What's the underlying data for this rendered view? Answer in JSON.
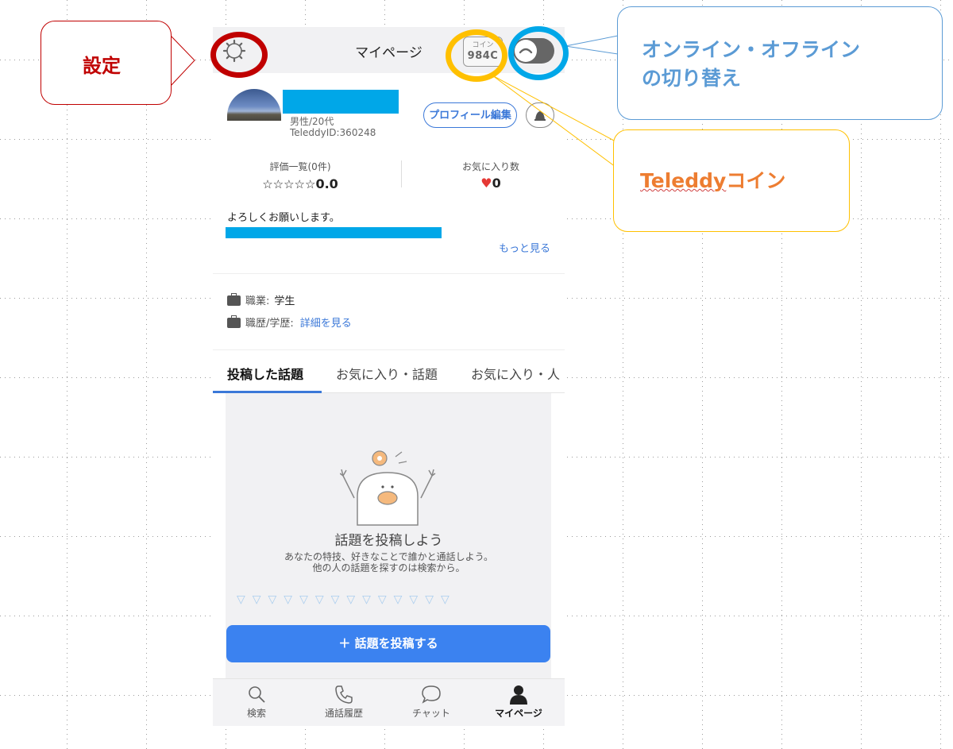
{
  "colors": {
    "settings_annotation": "#c00000",
    "online_annotation": "#5b9bd5",
    "coin_annotation": "#ffc000",
    "coin_text": "#ed7d31",
    "accent": "#3b82f0",
    "redaction": "#00a7e8"
  },
  "header": {
    "title": "マイページ",
    "coin_label": "コイン",
    "coin_value": "984C"
  },
  "profile": {
    "sub": "男性/20代",
    "id": "TeleddyID:360248",
    "edit_label": "プロフィール編集"
  },
  "stats": {
    "rating_label": "評価一覧(0件)",
    "stars": "☆☆☆☆☆",
    "rating_value": "0.0",
    "fav_label": "お気に入り数",
    "fav_value": "0"
  },
  "bio": {
    "text": "よろしくお願いします。",
    "more": "もっと見る"
  },
  "career": {
    "job_label": "職業:",
    "job_value": "学生",
    "edu_label": "職歴/学歴:",
    "edu_link": "詳細を見る"
  },
  "tabs": [
    {
      "label": "投稿した話題"
    },
    {
      "label": "お気に入り・話題"
    },
    {
      "label": "お気に入り・人"
    }
  ],
  "empty_state": {
    "title": "話題を投稿しよう",
    "desc1": "あなたの特技、好きなことで誰かと通話しよう。",
    "desc2": "他の人の話題を探すのは検索から。"
  },
  "post_button": {
    "label": "＋  話題を投稿する"
  },
  "bottom_nav": [
    {
      "label": "検索",
      "icon": "search-icon"
    },
    {
      "label": "通話履歴",
      "icon": "phone-icon"
    },
    {
      "label": "チャット",
      "icon": "chat-icon"
    },
    {
      "label": "マイページ",
      "icon": "person-icon"
    }
  ],
  "annotations": {
    "settings": "設定",
    "online_line1": "オンライン・オフライン",
    "online_line2": "の切り替え",
    "coin_brand": "Teleddy",
    "coin_suffix": "コイン"
  }
}
